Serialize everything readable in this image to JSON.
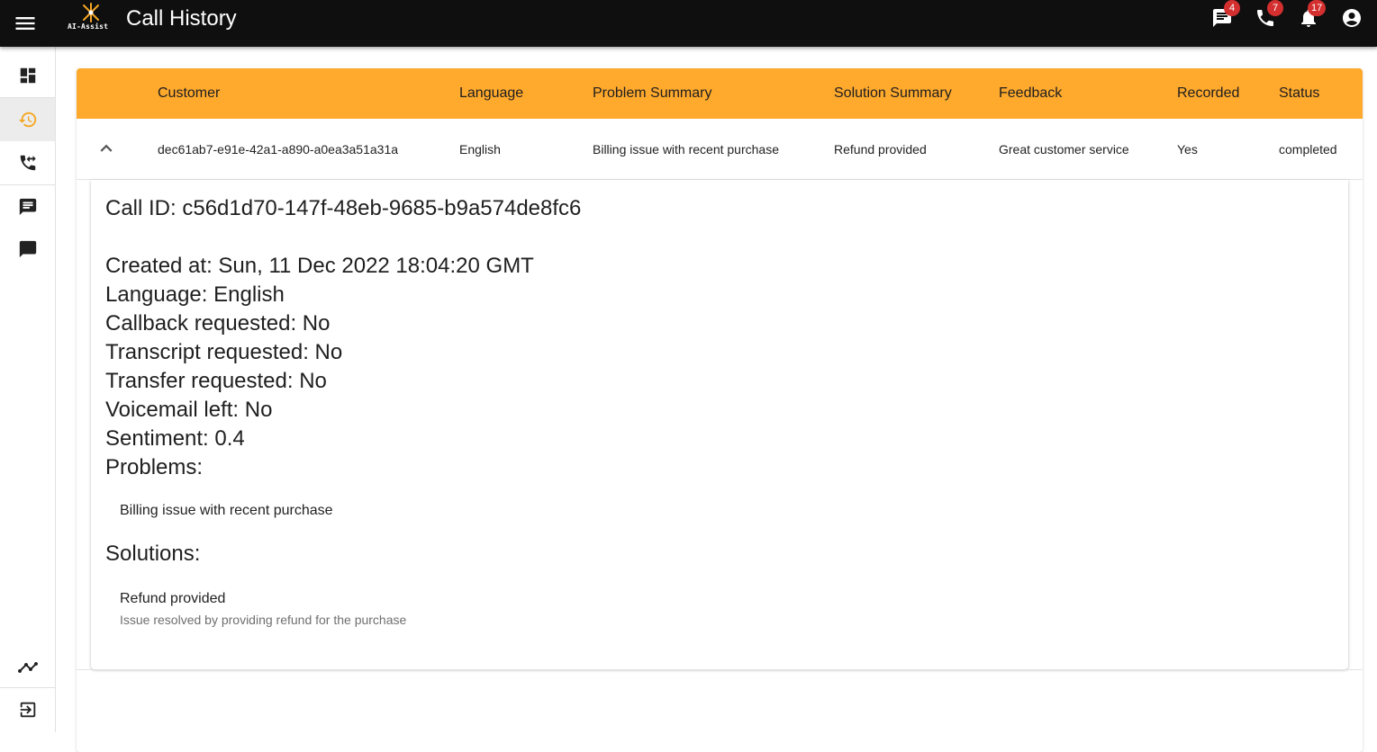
{
  "app": {
    "logo_text": "AI-Assist",
    "title": "Call History"
  },
  "topbar": {
    "icons": [
      {
        "icon": "chat-icon",
        "badge": "4"
      },
      {
        "icon": "phone-icon",
        "badge": "7"
      },
      {
        "icon": "bell-icon",
        "badge": "17"
      },
      {
        "icon": "account-icon"
      }
    ]
  },
  "sidebar": {
    "items": [
      "dashboard-icon",
      "history-icon",
      "call-transfer-icon",
      "message-icon",
      "chat-bubble-icon",
      "trending-icon",
      "logout-icon"
    ],
    "active": "history-icon"
  },
  "table": {
    "headers": [
      "Customer",
      "Language",
      "Problem Summary",
      "Solution Summary",
      "Feedback",
      "Recorded",
      "Status"
    ],
    "row": {
      "customer": "dec61ab7-e91e-42a1-a890-a0ea3a51a31a",
      "language": "English",
      "problem": "Billing issue with recent purchase",
      "solution": "Refund provided",
      "feedback": "Great customer service",
      "recorded": "Yes",
      "status": "completed"
    }
  },
  "detail": {
    "call_id": "Call ID: c56d1d70-147f-48eb-9685-b9a574de8fc6",
    "created_at": "Created at: Sun, 11 Dec 2022 18:04:20 GMT",
    "language": "Language: English",
    "callback": "Callback requested: No",
    "transcript": "Transcript requested: No",
    "transfer": "Transfer requested: No",
    "voicemail": "Voicemail left: No",
    "sentiment": "Sentiment: 0.4",
    "problems_heading": "Problems:",
    "problems": [
      "Billing issue with recent purchase"
    ],
    "solutions_heading": "Solutions:",
    "solutions": [
      {
        "title": "Refund provided",
        "description": "Issue resolved by providing refund for the purchase"
      }
    ]
  },
  "colors": {
    "topbar": "#0f0f0f",
    "header": "#ffa92d",
    "badge": "#d32f2f",
    "logo": "#f5a623"
  }
}
